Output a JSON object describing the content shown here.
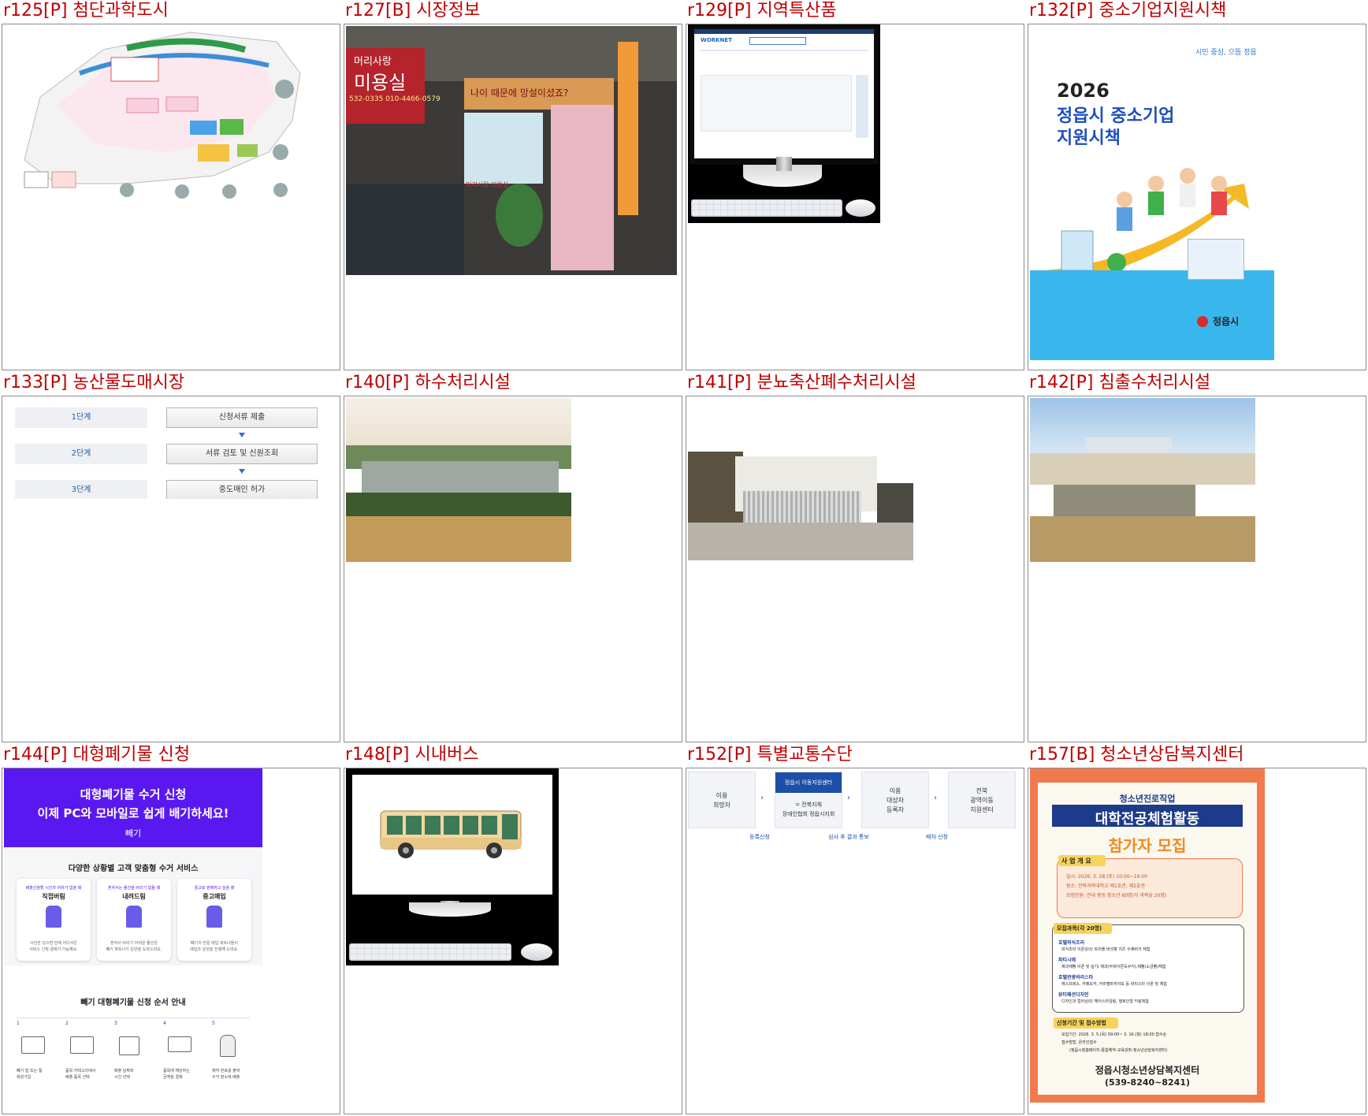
{
  "cells": [
    {
      "title": "r125[P] 첨단과학도시"
    },
    {
      "title": "r127[B] 시장정보",
      "photo_text": {
        "sign_top": "머리사랑",
        "sign_main": "미용실",
        "phone": "532-0335  010-4466-0579",
        "banner": "나이 때문에 망설이셨죠?",
        "window": "머리사랑 미용실"
      }
    },
    {
      "title": "r129[P] 지역특산품",
      "screen_logo": "WORKNET"
    },
    {
      "title": "r132[P] 중소기업지원시책",
      "cover": {
        "slogan": "시민 중심, 으뜸 정읍",
        "year": "2026",
        "line1": "정읍시 중소기업",
        "line2": "지원시책",
        "publisher": "정읍시"
      }
    },
    {
      "title": "r133[P] 농산물도매시장",
      "steps": [
        {
          "stage": "1단계",
          "action": "신청서류 제출"
        },
        {
          "stage": "2단계",
          "action": "서류 검토 및 신원조회"
        },
        {
          "stage": "3단계",
          "action": "중도매인 허가"
        }
      ]
    },
    {
      "title": "r140[P] 하수처리시설"
    },
    {
      "title": "r141[P] 분뇨축산폐수처리시설"
    },
    {
      "title": "r142[P] 침출수처리시설"
    },
    {
      "title": "r144[P] 대형폐기물 신청",
      "banner": {
        "line1": "대형폐기물 수거 신청",
        "line2": "이제 PC와 모바일로 쉽게 배기하세요!",
        "brand": "빼기"
      },
      "services_title": "다양한 상황별 고객 맞춤형 수거 서비스",
      "services": [
        {
          "sub": "배출신청할 시간과 여유가 없을 때",
          "name": "직접버림",
          "desc1": "사진만 있으면 언제 어디서든",
          "desc2": "서비스 신청·결제가 가능해요."
        },
        {
          "sub": "혼자서는 물건을 버리기 힘들 때",
          "name": "내려드림",
          "desc1": "혼자서 버리기 어려운 물건은",
          "desc2": "빼기 파트너가 운반을 도와드려요."
        },
        {
          "sub": "중고로 판매하고 싶을 때",
          "name": "중고매입",
          "desc1": "빼기의 전문 매입 파트너들이",
          "desc2": "매입과 운반을 진행해 드려요."
        }
      ],
      "guide_title": "빼기 대형폐기물 신청 순서 안내",
      "guide_steps": [
        {
          "num": "1",
          "l1": "빼기 앱 또는 웹",
          "l2": "회원가입"
        },
        {
          "num": "2",
          "l1": "품목 카테고리에서",
          "l2": "배출 품목 선택"
        },
        {
          "num": "3",
          "l1": "배출 날짜와",
          "l2": "시간 선택"
        },
        {
          "num": "4",
          "l1": "품목에 해당하는",
          "l2": "금액을 결제"
        },
        {
          "num": "5",
          "l1": "예약 번호를 붙여",
          "l2": "수거 장소에 배출"
        }
      ]
    },
    {
      "title": "r148[P] 시내버스"
    },
    {
      "title": "r152[P] 특별교통수단",
      "flow": {
        "box1": [
          "이용",
          "희망자"
        ],
        "box2_head": "정읍시 이동지원센터",
        "box2_body": [
          "= 전북지체",
          "장애인협회 정읍시지회"
        ],
        "box3": [
          "이용",
          "대상자",
          "등록자"
        ],
        "box4": [
          "전북",
          "광역이동",
          "지원센터"
        ],
        "labels": [
          "등록신청",
          "심사 후 결과 통보",
          "배차 신청"
        ]
      }
    },
    {
      "title": "r157[B] 청소년상담복지센터",
      "poster": {
        "kicker": "청소년진로직업",
        "headline": "대학전공체험활동",
        "sub": "참가자 모집",
        "overview_title": "사 업 개 요",
        "overview": [
          "일시: 2026. 3. 28.(토) 10:00~16:00",
          "장소: 전북과학대학교 제1호관, 제2호관",
          "모집인원: 관내 중등 청소년 80명(각 과목당 20명)"
        ],
        "courses_title": "모집과목(각 20명)",
        "courses": [
          {
            "name": "호텔외식조리",
            "desc": "외식조리 이론강의/ 트러플 버섯향 치즈 수제버거 체험"
          },
          {
            "name": "파티시에",
            "desc": "제과제빵 이론 및 실기/ 제과(두바이쫀득쿠키),제빵(소금빵)체험"
          },
          {
            "name": "호텔관광바리스타",
            "desc": "에스프레소, 카페모카, 카라멜마끼아또 등 바리스타 이론 및 체험"
          },
          {
            "name": "뷰티패션디자인",
            "desc": "디자인과 컬러심리/ 헤어스타일링, 행복인형 키링체험"
          }
        ],
        "apply_title": "신청기간 및 접수방법",
        "apply": [
          "모집기간: 2026. 3. 5.(목) 09:00~ 3. 16.(월) 18:00 접수순",
          "접수방법: 온라인접수",
          "(정읍시청홈페이지-통합예약-교육강좌-청소년상담복지센터)"
        ],
        "org": "정읍시청소년상담복지센터",
        "phone": "(539-8240~8241)"
      }
    }
  ]
}
